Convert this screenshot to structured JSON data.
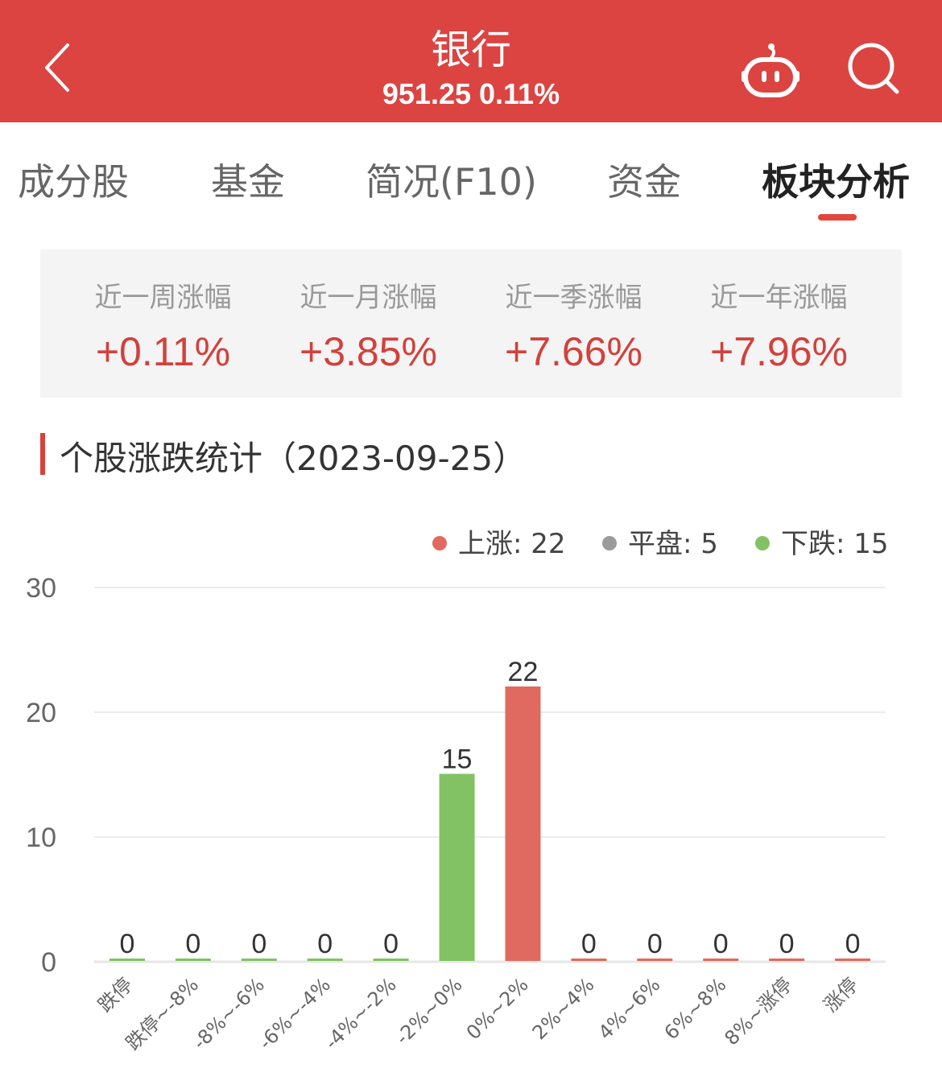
{
  "header": {
    "title": "银行",
    "subtitle": "951.25 0.11%",
    "icons": [
      "back-arrow-icon",
      "robot-assistant-icon",
      "search-icon"
    ]
  },
  "tabs": [
    {
      "label": "成分股",
      "active": false
    },
    {
      "label": "基金",
      "active": false
    },
    {
      "label": "简况(F10)",
      "active": false
    },
    {
      "label": "资金",
      "active": false
    },
    {
      "label": "板块分析",
      "active": true
    }
  ],
  "performance": [
    {
      "label": "近一周涨幅",
      "value": "+0.11%"
    },
    {
      "label": "近一月涨幅",
      "value": "+3.85%"
    },
    {
      "label": "近一季涨幅",
      "value": "+7.66%"
    },
    {
      "label": "近一年涨幅",
      "value": "+7.96%"
    }
  ],
  "section": {
    "title": "个股涨跌统计（2023-09-25）"
  },
  "legend": [
    {
      "label": "上涨: 22",
      "color": "#e06a5f"
    },
    {
      "label": "平盘: 5",
      "color": "#9b9b9b"
    },
    {
      "label": "下跌: 15",
      "color": "#82c264"
    }
  ],
  "colors": {
    "header_bg": "#db4441",
    "up": "#e06a5f",
    "down": "#82c264",
    "flat": "#9b9b9b",
    "value_red": "#d2413c"
  },
  "chart_data": {
    "type": "bar",
    "title": "个股涨跌统计（2023-09-25）",
    "xlabel": "",
    "ylabel": "",
    "ylim": [
      0,
      30
    ],
    "yticks": [
      0,
      10,
      20,
      30
    ],
    "grid": true,
    "legend_position": "top-right",
    "categories": [
      "跌停",
      "跌停~-8%",
      "-8%~-6%",
      "-6%~-4%",
      "-4%~-2%",
      "-2%~0%",
      "0%~2%",
      "2%~4%",
      "4%~6%",
      "6%~8%",
      "8%~涨停",
      "涨停"
    ],
    "values": [
      0,
      0,
      0,
      0,
      0,
      15,
      22,
      0,
      0,
      0,
      0,
      0
    ],
    "bar_colors": [
      "down",
      "down",
      "down",
      "down",
      "down",
      "down",
      "up",
      "up",
      "up",
      "up",
      "up",
      "up"
    ],
    "summary": {
      "up": 22,
      "flat": 5,
      "down": 15
    }
  }
}
